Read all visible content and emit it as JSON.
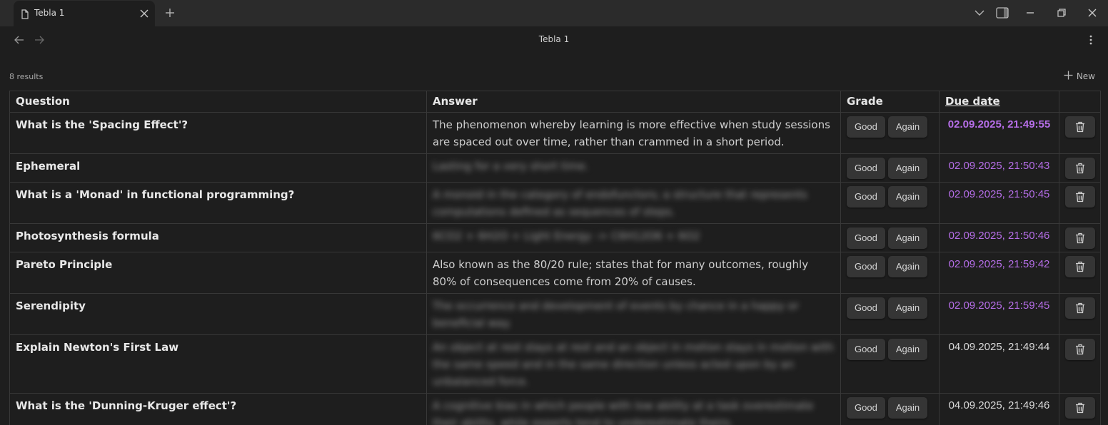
{
  "tab": {
    "label": "Tebla 1"
  },
  "view": {
    "title": "Tebla 1"
  },
  "toolbar": {
    "results": "8 results",
    "new_label": "New"
  },
  "columns": {
    "question": "Question",
    "answer": "Answer",
    "grade": "Grade",
    "due": "Due date"
  },
  "buttons": {
    "good": "Good",
    "again": "Again"
  },
  "colors": {
    "due_accent": "#b66ee8",
    "due_normal": "#dadada"
  },
  "rows": [
    {
      "question": "What is the 'Spacing Effect'?",
      "answer": "The phenomenon whereby learning is more effective when study sessions are spaced out over time, rather than crammed in a short period.",
      "answer_blurred": false,
      "due": "02.09.2025, 21:49:55"
    },
    {
      "question": "Ephemeral",
      "answer": "Lasting for a very short time.",
      "answer_blurred": true,
      "due": "02.09.2025, 21:50:43"
    },
    {
      "question": "What is a 'Monad' in functional programming?",
      "answer": "A monoid in the category of endofunctors; a structure that represents computations defined as sequences of steps.",
      "answer_blurred": true,
      "due": "02.09.2025, 21:50:45"
    },
    {
      "question": "Photosynthesis formula",
      "answer": "6CO2 + 6H2O + Light Energy -> C6H12O6 + 6O2",
      "answer_blurred": true,
      "due": "02.09.2025, 21:50:46"
    },
    {
      "question": "Pareto Principle",
      "answer": "Also known as the 80/20 rule; states that for many outcomes, roughly 80% of consequences come from 20% of causes.",
      "answer_blurred": false,
      "due": "02.09.2025, 21:59:42"
    },
    {
      "question": "Serendipity",
      "answer": "The occurrence and development of events by chance in a happy or beneficial way.",
      "answer_blurred": true,
      "due": "02.09.2025, 21:59:45"
    },
    {
      "question": "Explain Newton's First Law",
      "answer": "An object at rest stays at rest and an object in motion stays in motion with the same speed and in the same direction unless acted upon by an unbalanced force.",
      "answer_blurred": true,
      "due": "04.09.2025, 21:49:44"
    },
    {
      "question": "What is the 'Dunning-Kruger effect'?",
      "answer": "A cognitive bias in which people with low ability at a task overestimate their ability, while experts tend to underestimate theirs.",
      "answer_blurred": true,
      "due": "04.09.2025, 21:49:46"
    }
  ]
}
